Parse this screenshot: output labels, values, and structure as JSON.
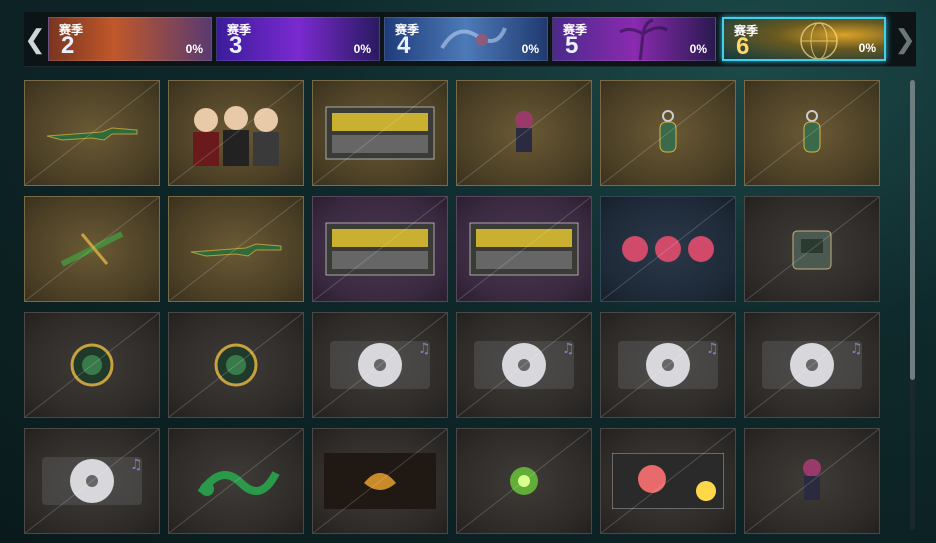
{
  "seasons": [
    {
      "label": "赛季",
      "number": "2",
      "percent": "0%"
    },
    {
      "label": "赛季",
      "number": "3",
      "percent": "0%"
    },
    {
      "label": "赛季",
      "number": "4",
      "percent": "0%"
    },
    {
      "label": "赛季",
      "number": "5",
      "percent": "0%"
    },
    {
      "label": "赛季",
      "number": "6",
      "percent": "0%"
    }
  ],
  "selected_season": "6",
  "nav": {
    "prev_icon": "chevron-left-icon",
    "next_icon": "chevron-right-icon"
  },
  "reward_items": [
    {
      "icon": "rifle-icon"
    },
    {
      "icon": "character-trio-icon"
    },
    {
      "icon": "weapon-crate-icon"
    },
    {
      "icon": "character-figure-icon"
    },
    {
      "icon": "keychain-icon"
    },
    {
      "icon": "keychain-icon"
    },
    {
      "icon": "crossbow-icon"
    },
    {
      "icon": "rifle-icon"
    },
    {
      "icon": "weapon-crate-icon"
    },
    {
      "icon": "weapon-crate-icon"
    },
    {
      "icon": "chibi-sticker-icon"
    },
    {
      "icon": "backpack-icon"
    },
    {
      "icon": "emblem-icon"
    },
    {
      "icon": "emblem-icon"
    },
    {
      "icon": "music-disc-icon"
    },
    {
      "icon": "music-disc-icon"
    },
    {
      "icon": "music-disc-icon"
    },
    {
      "icon": "music-disc-icon"
    },
    {
      "icon": "music-disc-icon"
    },
    {
      "icon": "snake-spray-icon"
    },
    {
      "icon": "cobra-banner-icon"
    },
    {
      "icon": "green-orb-icon"
    },
    {
      "icon": "emoji-sticker-icon"
    },
    {
      "icon": "character-figure-icon"
    }
  ],
  "colors": {
    "accent": "#3fd0ea",
    "gold": "#ffd86a"
  }
}
